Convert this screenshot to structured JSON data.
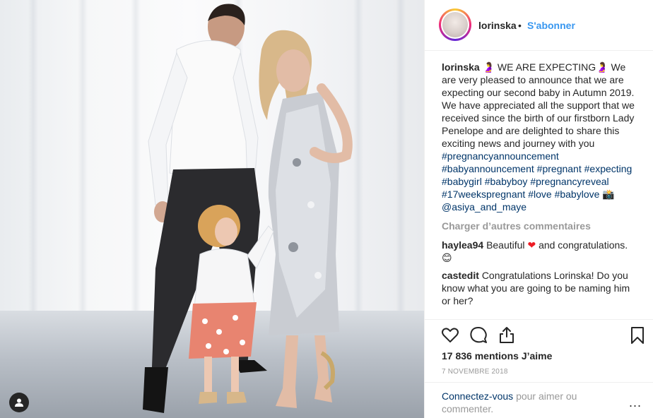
{
  "post": {
    "username": "lorinska",
    "follow_label": "S'abonner",
    "separator": "•",
    "caption": {
      "username": "lorinska",
      "emoji_1": "🤰",
      "headline": "WE ARE EXPECTING",
      "emoji_2": "🤰",
      "text": "We are very pleased to announce that we are expecting our second baby in Autumn 2019.",
      "text2": "We have appreciated all the support that we received since the birth of our firstborn Lady Penelope and are delighted to share this exciting news and journey with you",
      "hashtags": [
        "#pregnancyannouncement",
        "#babyannouncement",
        "#pregnant",
        "#expecting",
        "#babygirl",
        "#babyboy",
        "#pregnancyreveal",
        "#17weekspregnant",
        "#love",
        "#babylove"
      ],
      "camera_emoji": "📸",
      "mention": "@asiya_and_maye"
    },
    "load_more": "Charger d’autres commentaires",
    "comments": [
      {
        "username": "haylea94",
        "text_before": "Beautiful",
        "emoji": "❤",
        "text_after": "and congratulations.",
        "emoji2": "😊"
      },
      {
        "username": "castedit",
        "text": "Congratulations Lorinska! Do you know what you are going to be naming him or her?"
      }
    ],
    "likes": "17 836 mentions J’aime",
    "date": "7 NOVEMBRE 2018",
    "login_link": "Connectez-vous",
    "login_text": "pour aimer ou commenter.",
    "more_label": "..."
  },
  "icons": {
    "like": "heart-icon",
    "comment": "comment-bubble-icon",
    "share": "share-icon",
    "save": "bookmark-icon",
    "user_tag": "user-icon"
  },
  "colors": {
    "link": "#003569",
    "follow": "#3897f0",
    "muted": "#999999",
    "text": "#262626"
  }
}
